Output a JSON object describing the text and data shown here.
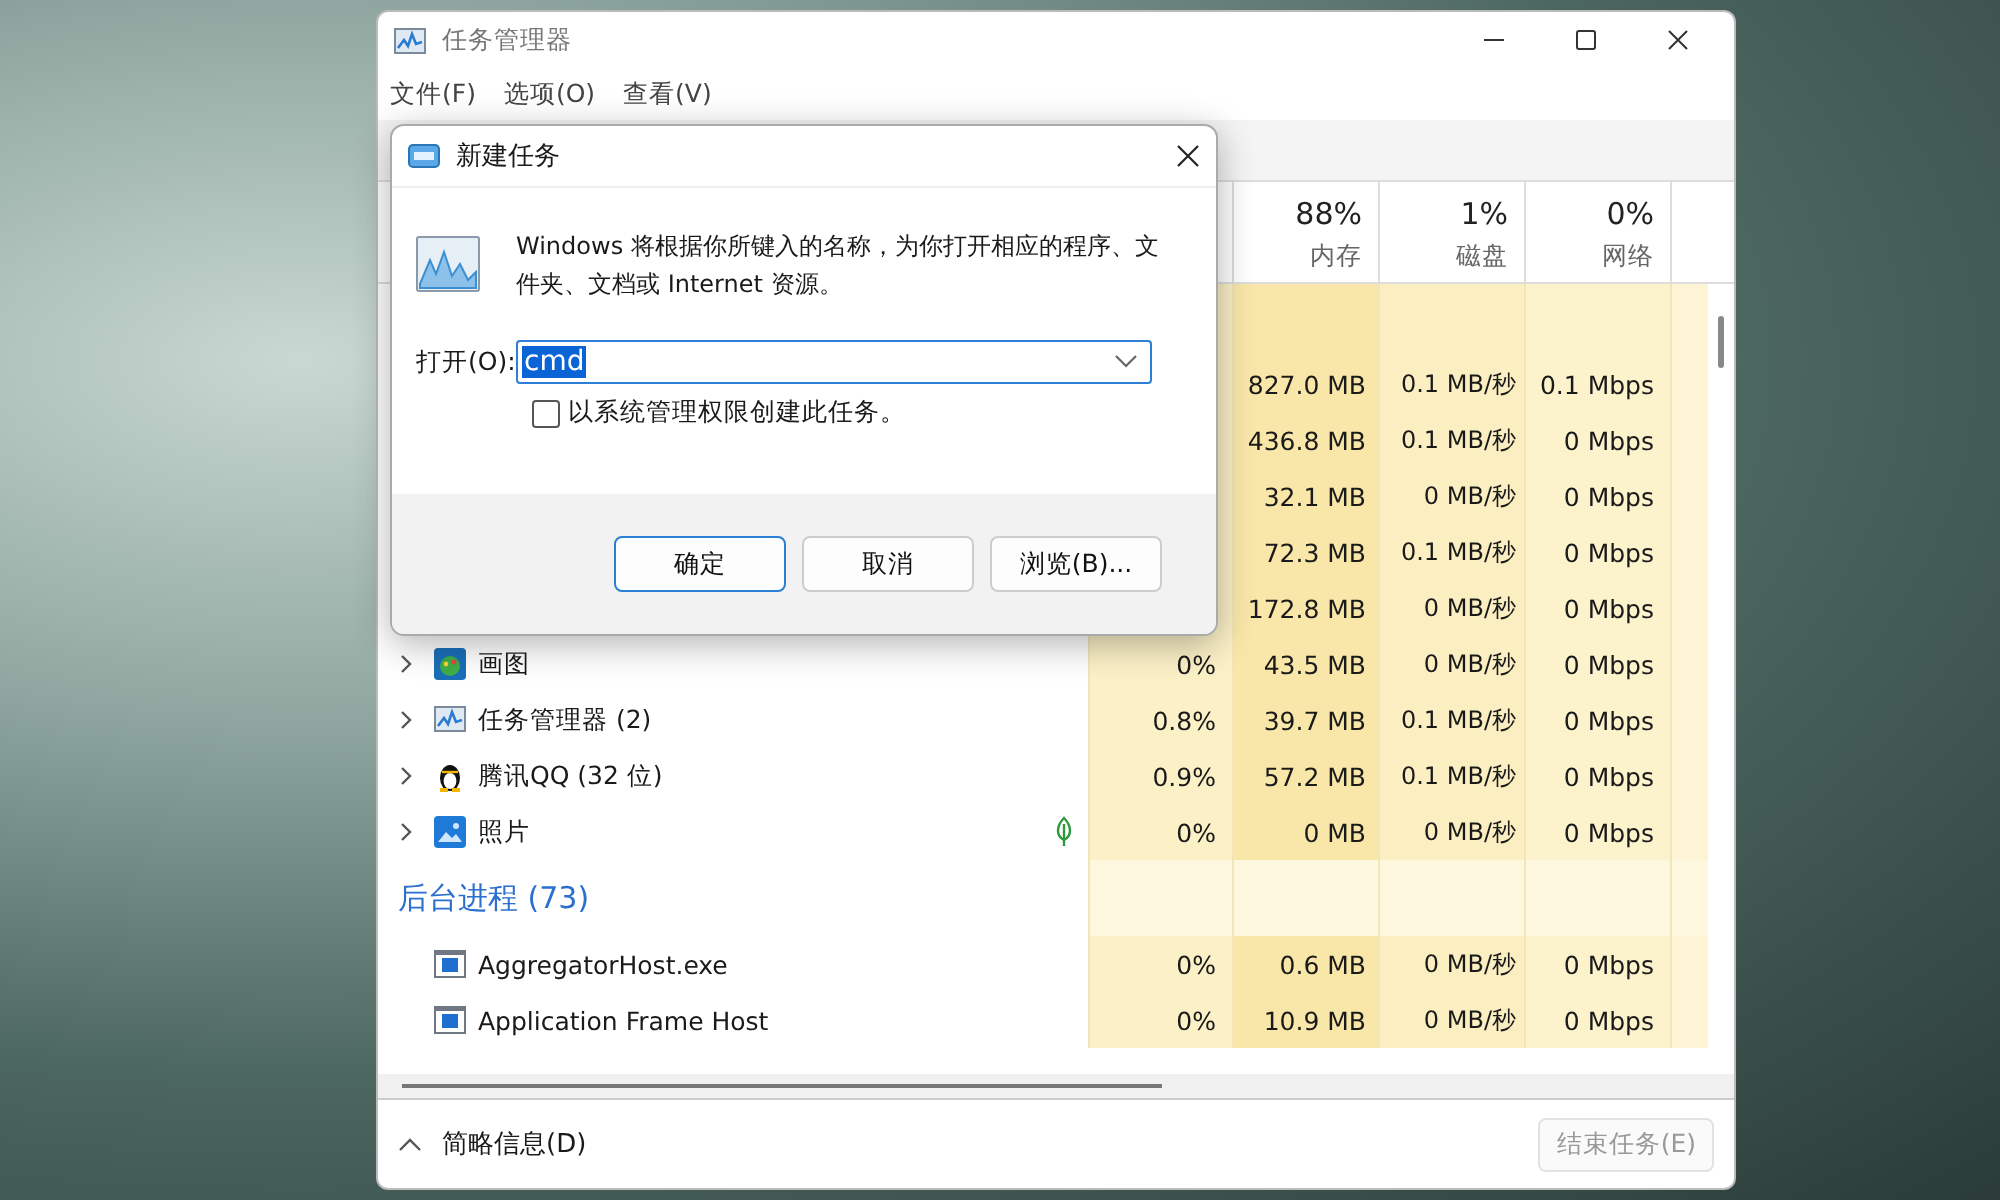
{
  "task_manager": {
    "title": "任务管理器",
    "menu": [
      {
        "label": "文件(F)"
      },
      {
        "label": "选项(O)"
      },
      {
        "label": "查看(V)"
      }
    ],
    "columns": [
      {
        "percent": "88%",
        "label": "内存"
      },
      {
        "percent": "1%",
        "label": "磁盘"
      },
      {
        "percent": "0%",
        "label": "网络"
      }
    ],
    "rows": [
      {
        "kind": "hidden",
        "memory": "827.0 MB",
        "disk": "0.1 MB/秒",
        "network": "0.1 Mbps"
      },
      {
        "kind": "hidden",
        "memory": "436.8 MB",
        "disk": "0.1 MB/秒",
        "network": "0 Mbps"
      },
      {
        "kind": "hidden",
        "memory": "32.1 MB",
        "disk": "0 MB/秒",
        "network": "0 Mbps"
      },
      {
        "kind": "hidden",
        "memory": "72.3 MB",
        "disk": "0.1 MB/秒",
        "network": "0 Mbps"
      },
      {
        "kind": "hidden",
        "memory": "172.8 MB",
        "disk": "0 MB/秒",
        "network": "0 Mbps"
      },
      {
        "kind": "paint",
        "name": "画图",
        "efficiency": false,
        "cpu": "0%",
        "memory": "43.5 MB",
        "disk": "0 MB/秒",
        "network": "0 Mbps"
      },
      {
        "kind": "monitor",
        "name": "任务管理器 (2)",
        "efficiency": false,
        "cpu": "0.8%",
        "memory": "39.7 MB",
        "disk": "0.1 MB/秒",
        "network": "0 Mbps"
      },
      {
        "kind": "penguin",
        "name": "腾讯QQ (32 位)",
        "efficiency": false,
        "cpu": "0.9%",
        "memory": "57.2 MB",
        "disk": "0.1 MB/秒",
        "network": "0 Mbps"
      },
      {
        "kind": "photos",
        "name": "照片",
        "efficiency": true,
        "cpu": "0%",
        "memory": "0 MB",
        "disk": "0 MB/秒",
        "network": "0 Mbps"
      },
      {
        "kind": "group",
        "name": "后台进程 (73)"
      },
      {
        "kind": "process",
        "name": "AggregatorHost.exe",
        "cpu": "0%",
        "memory": "0.6 MB",
        "disk": "0 MB/秒",
        "network": "0 Mbps"
      },
      {
        "kind": "process",
        "name": "Application Frame Host",
        "cpu": "0%",
        "memory": "10.9 MB",
        "disk": "0 MB/秒",
        "network": "0 Mbps"
      }
    ],
    "footer": {
      "details": "简略信息(D)",
      "end_task": {
        "label": "结束任务(E)",
        "disabled": true
      }
    }
  },
  "dialog": {
    "title": "新建任务",
    "description": "Windows 将根据你所键入的名称，为你打开相应的程序、文件夹、文档或 Internet 资源。",
    "open_label": "打开(O):",
    "input": {
      "value": "cmd",
      "selected": true
    },
    "checkbox": {
      "label": "以系统管理权限创建此任务。",
      "checked": false
    },
    "buttons": [
      {
        "label": "确定",
        "default": true
      },
      {
        "label": "取消",
        "default": false
      },
      {
        "label": "浏览(B)...",
        "default": false
      }
    ]
  }
}
